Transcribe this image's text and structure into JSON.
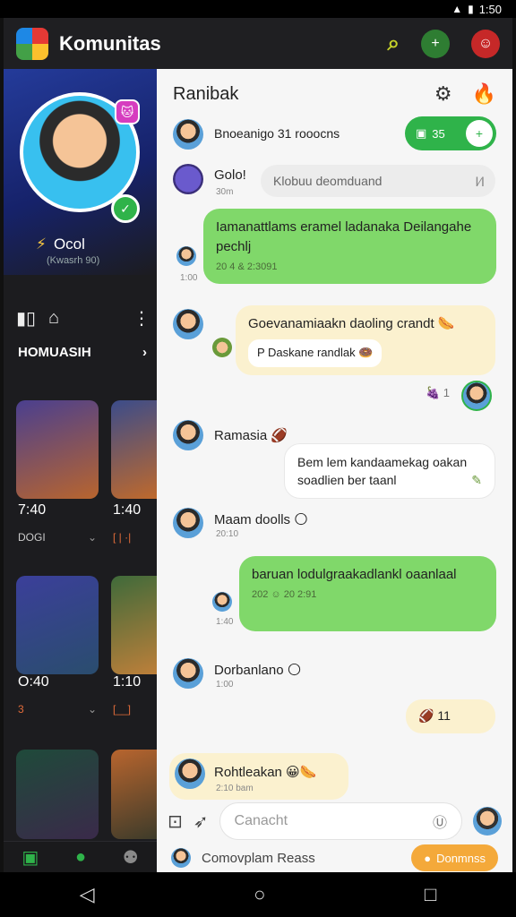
{
  "status": {
    "signal": "▲",
    "battery": "▮",
    "time": "1:50"
  },
  "app": {
    "title": "Komunitas",
    "search_icon": "search-icon",
    "friend_badge": "+",
    "profile_icon": "avatar"
  },
  "profile": {
    "name": "Ocol",
    "sub": "(Kwasrh 90)",
    "badge": "🐱",
    "online": "✓"
  },
  "sidebar": {
    "tools": [
      "▮▯",
      "⌂",
      "⋮"
    ],
    "section_label": "HOMUASIH",
    "section_chev": "›",
    "tiles": [
      {
        "time": "7:40",
        "sub": "DOGI",
        "chev": "⌄"
      },
      {
        "time": "1:40",
        "sub": "[ | ·|",
        "chev": ""
      },
      {
        "time": "O:40",
        "sub": "3",
        "chev": "⌄"
      },
      {
        "time": "1:10",
        "sub": "[__]",
        "chev": ""
      }
    ],
    "nav": [
      "▣",
      "●",
      "⚉"
    ]
  },
  "chat": {
    "title": "Ranibak",
    "tools": [
      "⚙",
      "🔥"
    ],
    "top_member": "Bnoeanigo 31 rooocns",
    "pill_label": "35",
    "pill_knob": "+",
    "messages": [
      {
        "name": "Golo!",
        "meta": "30m",
        "text": "Klobuu deomduand",
        "right": "Ⅰ⁄Ⅰ"
      },
      {
        "text": "Iamanattlams eramel ladanaka Deilangahe pechlj",
        "ts": "20 4 & 2:3091",
        "meta": "1:00"
      },
      {
        "text": "Goevanamiaakn daoling crandt 🌭",
        "sub": "P Daskane randlak 🍩",
        "reaction": "🍇 1"
      },
      {
        "name": "Ramasia 🏈",
        "text": "Bem lem kandaamekag oakan soadlien ber taanl",
        "emoji": "✎"
      },
      {
        "name": "Maam doolls 🌕",
        "meta": "20:10",
        "text": "baruan lodulgraakadlankl oaanlaal",
        "ts": "202 ☺ 20 2:91",
        "meta2": "1:40"
      },
      {
        "name": "Dorbanlano 🌕",
        "meta": "1:00",
        "reaction": "🏈 11"
      },
      {
        "name": "Rohtleakan 😀🌭",
        "meta": "2:10 bam"
      }
    ]
  },
  "composer": {
    "placeholder": "Canacht",
    "mic": "Ⓤ"
  },
  "bottom": {
    "member": "Comovplam Reass",
    "join": "Donmnss"
  },
  "navbar": {
    "back": "◁",
    "home": "○",
    "recent": "□"
  }
}
